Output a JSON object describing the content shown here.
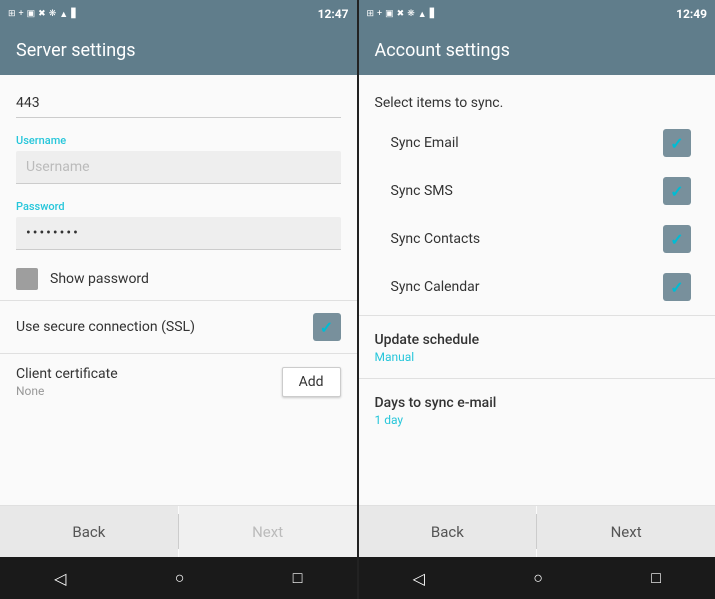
{
  "left_screen": {
    "status": {
      "time": "12:47"
    },
    "title": "Server settings",
    "port_value": "443",
    "username_label": "Username",
    "username_placeholder": "Username",
    "password_label": "Password",
    "password_value": "••••••••",
    "show_password_label": "Show password",
    "ssl_label": "Use secure connection (SSL)",
    "ssl_checked": true,
    "cert_label": "Client certificate",
    "cert_value": "None",
    "add_label": "Add",
    "back_label": "Back",
    "next_label": "Next",
    "next_disabled": true
  },
  "right_screen": {
    "status": {
      "time": "12:49"
    },
    "title": "Account settings",
    "select_label": "Select items to sync.",
    "sync_items": [
      {
        "label": "Sync Email",
        "checked": true
      },
      {
        "label": "Sync SMS",
        "checked": true
      },
      {
        "label": "Sync Contacts",
        "checked": true
      },
      {
        "label": "Sync Calendar",
        "checked": true
      }
    ],
    "update_schedule_label": "Update schedule",
    "update_schedule_value": "Manual",
    "days_to_sync_label": "Days to sync e-mail",
    "days_to_sync_value": "1 day",
    "back_label": "Back",
    "next_label": "Next"
  }
}
